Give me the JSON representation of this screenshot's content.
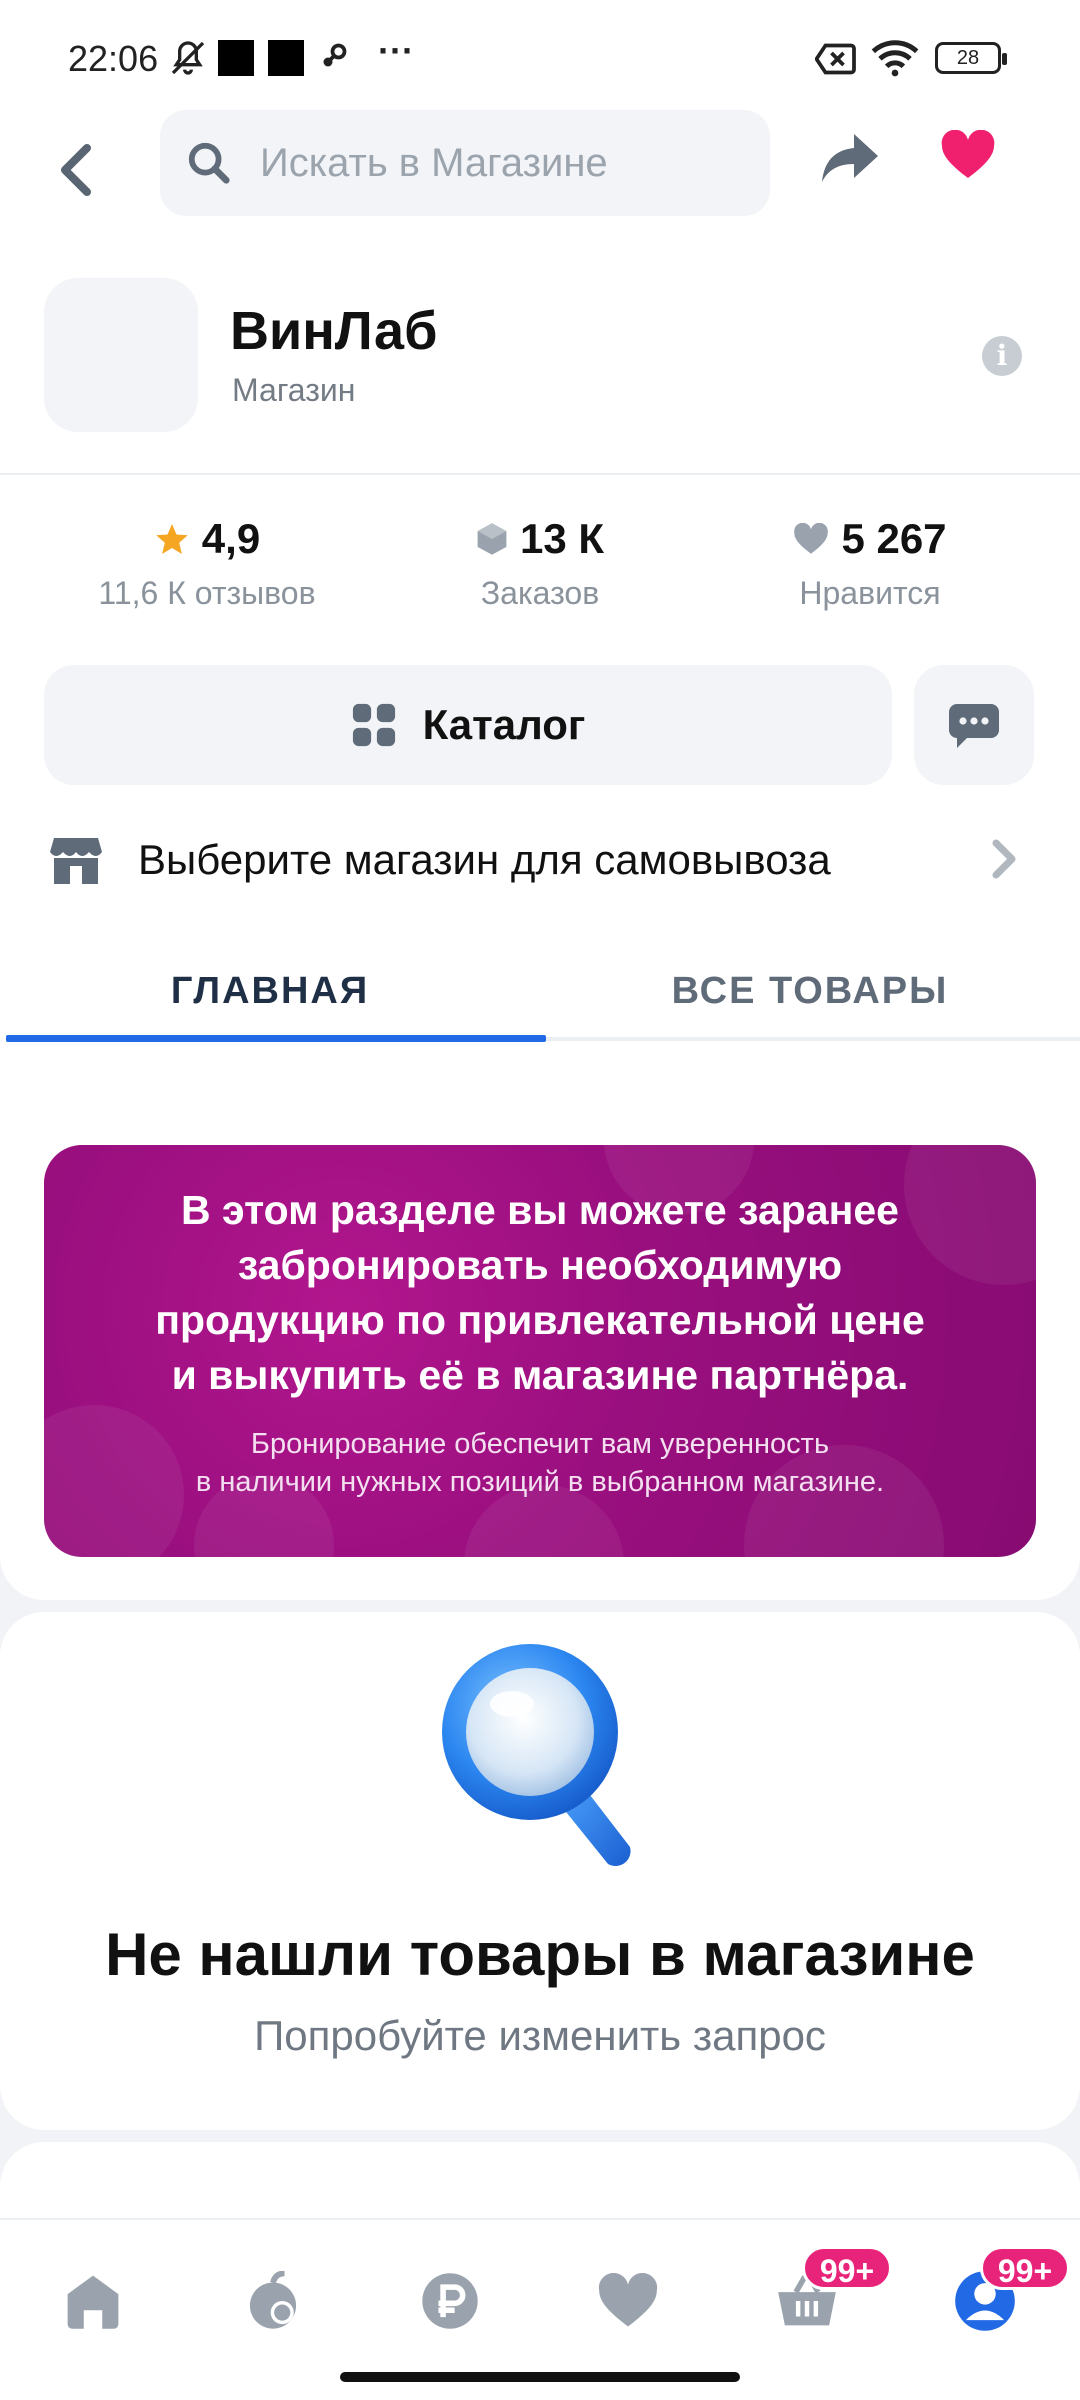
{
  "status_bar": {
    "time": "22:06",
    "more": "···",
    "battery": "28",
    "icons": [
      "bell-off-icon",
      "notification-square-icon",
      "notification-square-icon",
      "steam-icon",
      "no-sim-icon",
      "wifi-icon",
      "battery-icon"
    ]
  },
  "header": {
    "search_placeholder": "Искать в Магазине",
    "icons": [
      "back-arrow-icon",
      "search-icon",
      "share-icon",
      "heart-icon"
    ],
    "favorite_color": "#f0206f"
  },
  "shop": {
    "name": "ВинЛаб",
    "type": "Магазин",
    "info_glyph": "i"
  },
  "stats": {
    "rating": {
      "value": "4,9",
      "label": "11,6 К отзывов",
      "icon": "star-icon",
      "color": "#f5a623"
    },
    "orders": {
      "value": "13 К",
      "label": "Заказов",
      "icon": "box-icon"
    },
    "likes": {
      "value": "5 267",
      "label": "Нравится",
      "icon": "heart-icon"
    }
  },
  "actions": {
    "catalog_label": "Каталог",
    "catalog_icon": "grid-icon",
    "chat_icon": "chat-icon"
  },
  "pickup": {
    "label": "Выберите магазин для самовывоза",
    "icon": "store-icon"
  },
  "tabs": [
    {
      "label": "ГЛАВНАЯ",
      "active": true
    },
    {
      "label": "ВСЕ ТОВАРЫ",
      "active": false
    }
  ],
  "accent_color": "#2269e6",
  "banner": {
    "title_lines": [
      "В этом разделе вы можете заранее",
      "забронировать необходимую",
      "продукцию по привлекательной цене",
      "и выкупить её в магазине партнёра."
    ],
    "subtitle_lines": [
      "Бронирование обеспечит вам уверенность",
      "в наличии нужных позиций в выбранном магазине."
    ],
    "color": "#9a0f7f"
  },
  "empty_state": {
    "title": "Не нашли товары в магазине",
    "subtitle": "Попробуйте изменить запрос",
    "icon": "magnifier-icon"
  },
  "bottom_nav": {
    "items": [
      "home-icon",
      "fruit-icon",
      "ruble-icon",
      "heart-icon",
      "basket-icon",
      "profile-icon"
    ],
    "basket_badge": "99+",
    "profile_badge": "99+",
    "badge_color": "#e8247a"
  }
}
